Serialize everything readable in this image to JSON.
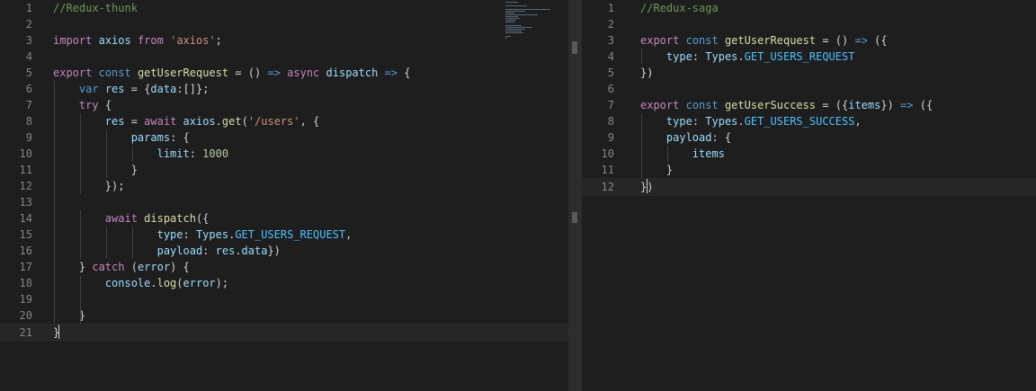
{
  "left_editor": {
    "lines": [
      {
        "n": "1",
        "c": "//Redux-thunk"
      },
      {
        "n": "2",
        "c": ""
      },
      {
        "n": "3",
        "c": "import axios from 'axios';"
      },
      {
        "n": "4",
        "c": ""
      },
      {
        "n": "5",
        "c": "export const getUserRequest = () => async dispatch => {"
      },
      {
        "n": "6",
        "c": "    var res = {data:[]};"
      },
      {
        "n": "7",
        "c": "    try {"
      },
      {
        "n": "8",
        "c": "        res = await axios.get('/users', {"
      },
      {
        "n": "9",
        "c": "            params: {"
      },
      {
        "n": "10",
        "c": "                limit: 1000"
      },
      {
        "n": "11",
        "c": "            }"
      },
      {
        "n": "12",
        "c": "        });"
      },
      {
        "n": "13",
        "c": ""
      },
      {
        "n": "14",
        "c": "        await dispatch({"
      },
      {
        "n": "15",
        "c": "                type: Types.GET_USERS_REQUEST,"
      },
      {
        "n": "16",
        "c": "                payload: res.data})"
      },
      {
        "n": "17",
        "c": "    } catch (error) {"
      },
      {
        "n": "18",
        "c": "        console.log(error);"
      },
      {
        "n": "19",
        "c": ""
      },
      {
        "n": "20",
        "c": "    }"
      },
      {
        "n": "21",
        "c": "}"
      }
    ]
  },
  "right_editor": {
    "lines": [
      {
        "n": "1",
        "c": "//Redux-saga"
      },
      {
        "n": "2",
        "c": ""
      },
      {
        "n": "3",
        "c": "export const getUserRequest = () => ({"
      },
      {
        "n": "4",
        "c": "    type: Types.GET_USERS_REQUEST"
      },
      {
        "n": "5",
        "c": "})"
      },
      {
        "n": "6",
        "c": ""
      },
      {
        "n": "7",
        "c": "export const getUserSuccess = ({items}) => ({"
      },
      {
        "n": "8",
        "c": "    type: Types.GET_USERS_SUCCESS,"
      },
      {
        "n": "9",
        "c": "    payload: {"
      },
      {
        "n": "10",
        "c": "        items"
      },
      {
        "n": "11",
        "c": "    }"
      },
      {
        "n": "12",
        "c": "})"
      }
    ]
  }
}
